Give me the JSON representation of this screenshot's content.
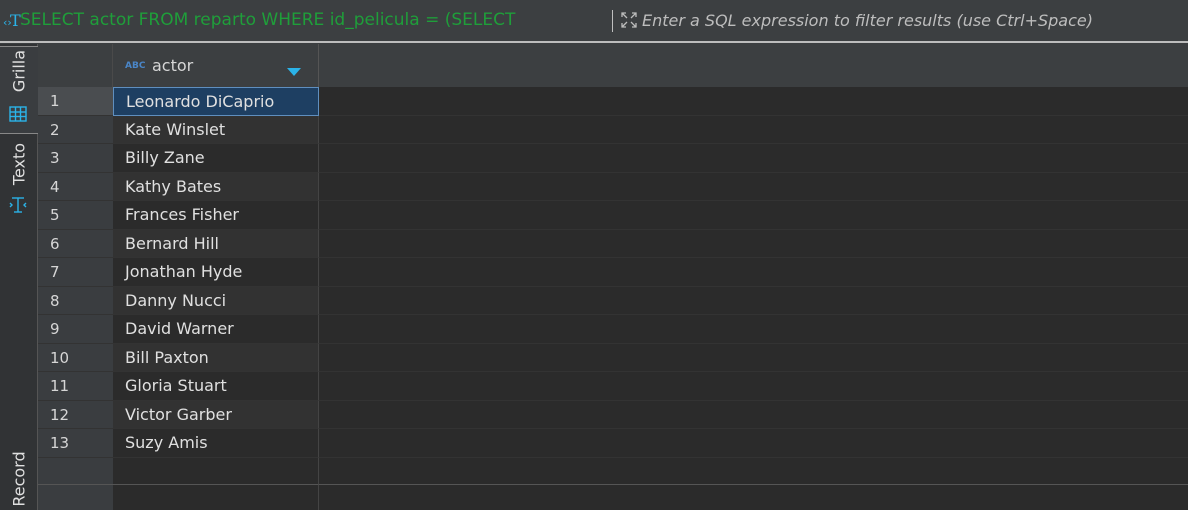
{
  "filter_bar": {
    "sql_text": "SELECT actor FROM reparto WHERE id_pelicula = (SELECT",
    "placeholder": "Enter a SQL expression to filter results (use Ctrl+Space)"
  },
  "side_tabs": {
    "grilla": "Grilla",
    "texto": "Texto",
    "record": "Record"
  },
  "grid": {
    "column": {
      "type_badge": "ABC",
      "name": "actor"
    },
    "selected_row": 1,
    "rows": [
      {
        "num": "1",
        "actor": "Leonardo DiCaprio"
      },
      {
        "num": "2",
        "actor": "Kate Winslet"
      },
      {
        "num": "3",
        "actor": "Billy Zane"
      },
      {
        "num": "4",
        "actor": "Kathy Bates"
      },
      {
        "num": "5",
        "actor": "Frances Fisher"
      },
      {
        "num": "6",
        "actor": "Bernard Hill"
      },
      {
        "num": "7",
        "actor": "Jonathan Hyde"
      },
      {
        "num": "8",
        "actor": "Danny Nucci"
      },
      {
        "num": "9",
        "actor": "David Warner"
      },
      {
        "num": "10",
        "actor": "Bill Paxton"
      },
      {
        "num": "11",
        "actor": "Gloria Stuart"
      },
      {
        "num": "12",
        "actor": "Victor Garber"
      },
      {
        "num": "13",
        "actor": "Suzy Amis"
      }
    ]
  },
  "colors": {
    "accent": "#2bb3e8",
    "sql_text": "#1f9e3a",
    "selection": "#1e3f62"
  },
  "icons": {
    "sql": "sql-editor-icon",
    "expand": "expand-icon",
    "grid": "grid-icon",
    "text": "text-icon",
    "sort": "sort-arrow-icon"
  }
}
